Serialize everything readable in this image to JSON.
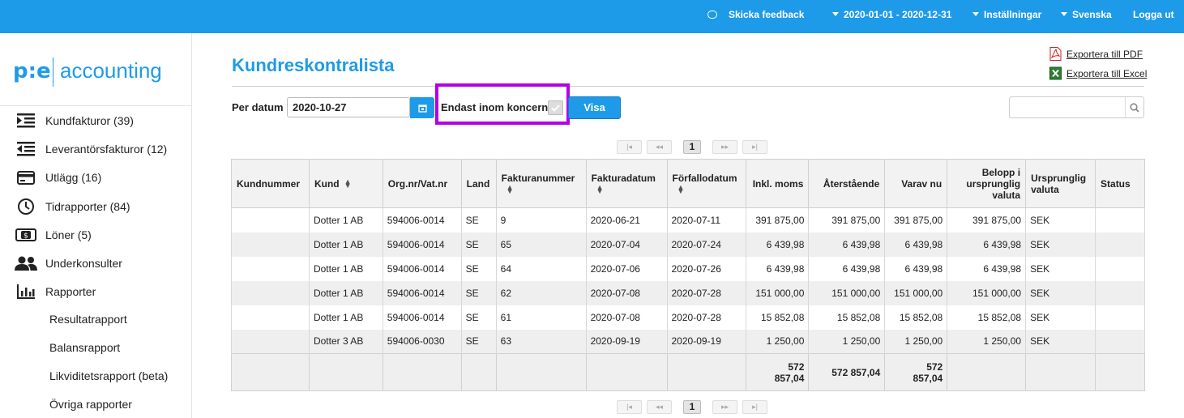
{
  "topbar": {
    "feedback": "Skicka feedback",
    "period": "2020-01-01 - 2020-12-31",
    "settings": "Inställningar",
    "language": "Svenska",
    "logout": "Logga ut"
  },
  "logo": {
    "mark": "p:e",
    "text": "accounting"
  },
  "sidebar": {
    "items": [
      {
        "label": "Kundfakturor (39)",
        "icon": "indent-right-icon"
      },
      {
        "label": "Leverantörsfakturor (12)",
        "icon": "indent-left-icon"
      },
      {
        "label": "Utlägg (16)",
        "icon": "credit-card-icon"
      },
      {
        "label": "Tidrapporter (84)",
        "icon": "clock-icon"
      },
      {
        "label": "Löner (5)",
        "icon": "money-icon"
      },
      {
        "label": "Underkonsulter",
        "icon": "people-icon"
      },
      {
        "label": "Rapporter",
        "icon": "bar-chart-icon"
      }
    ],
    "subitems": [
      "Resultatrapport",
      "Balansrapport",
      "Likviditetsrapport (beta)",
      "Övriga rapporter"
    ]
  },
  "page": {
    "title": "Kundreskontralista",
    "export_pdf": "Exportera till PDF",
    "export_excel": "Exportera till Excel"
  },
  "filters": {
    "date_label": "Per datum",
    "date_value": "2020-10-27",
    "koncern_label": "Endast inom koncern",
    "koncern_checked": true,
    "visa_label": "Visa",
    "search_value": ""
  },
  "pager": {
    "current_page": "1",
    "first": "|◂",
    "prev": "◂◂",
    "next": "▸▸",
    "last": "▸|"
  },
  "table": {
    "headers": [
      "Kundnummer",
      "Kund",
      "Org.nr/Vat.nr",
      "Land",
      "Fakturanummer",
      "Fakturadatum",
      "Förfallodatum",
      "Inkl. moms",
      "Återstående",
      "Varav nu",
      "Belopp i ursprunglig valuta",
      "Ursprunglig valuta",
      "Status"
    ],
    "rows": [
      [
        "",
        "Dotter 1 AB",
        "594006-0014",
        "SE",
        "9",
        "2020-06-21",
        "2020-07-11",
        "391 875,00",
        "391 875,00",
        "391 875,00",
        "391 875,00",
        "SEK",
        ""
      ],
      [
        "",
        "Dotter 1 AB",
        "594006-0014",
        "SE",
        "65",
        "2020-07-04",
        "2020-07-24",
        "6 439,98",
        "6 439,98",
        "6 439,98",
        "6 439,98",
        "SEK",
        ""
      ],
      [
        "",
        "Dotter 1 AB",
        "594006-0014",
        "SE",
        "64",
        "2020-07-06",
        "2020-07-26",
        "6 439,98",
        "6 439,98",
        "6 439,98",
        "6 439,98",
        "SEK",
        ""
      ],
      [
        "",
        "Dotter 1 AB",
        "594006-0014",
        "SE",
        "62",
        "2020-07-08",
        "2020-07-28",
        "151 000,00",
        "151 000,00",
        "151 000,00",
        "151 000,00",
        "SEK",
        ""
      ],
      [
        "",
        "Dotter 1 AB",
        "594006-0014",
        "SE",
        "61",
        "2020-07-08",
        "2020-07-28",
        "15 852,08",
        "15 852,08",
        "15 852,08",
        "15 852,08",
        "SEK",
        ""
      ],
      [
        "",
        "Dotter 3 AB",
        "594006-0030",
        "SE",
        "63",
        "2020-09-19",
        "2020-09-19",
        "1 250,00",
        "1 250,00",
        "1 250,00",
        "1 250,00",
        "SEK",
        ""
      ]
    ],
    "totals": {
      "inkl_moms_line1": "572",
      "inkl_moms_line2": "857,04",
      "aterstaende": "572 857,04",
      "varav_nu_line1": "572",
      "varav_nu_line2": "857,04"
    }
  }
}
